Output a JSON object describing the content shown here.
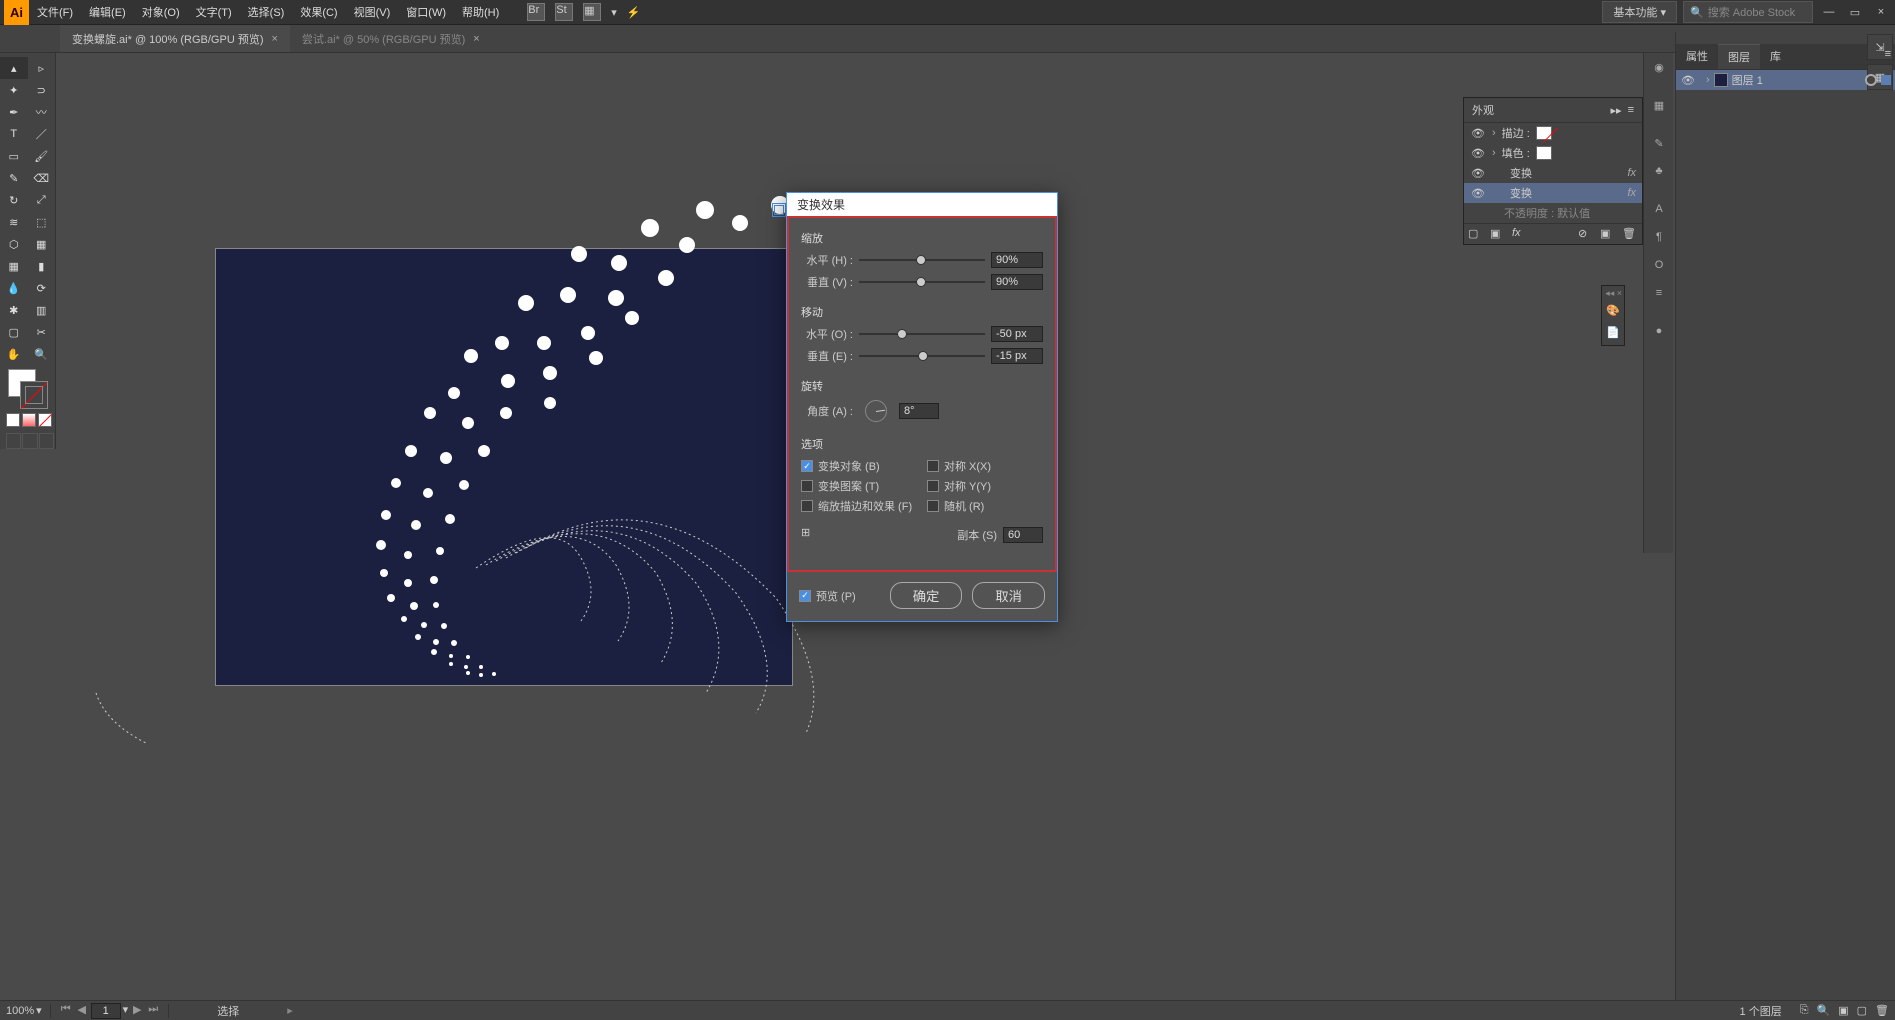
{
  "menu": {
    "items": [
      "文件(F)",
      "编辑(E)",
      "对象(O)",
      "文字(T)",
      "选择(S)",
      "效果(C)",
      "视图(V)",
      "窗口(W)",
      "帮助(H)"
    ],
    "workspace": "基本功能",
    "search_placeholder": "搜索 Adobe Stock"
  },
  "tabs": [
    {
      "label": "变换螺旋.ai* @ 100% (RGB/GPU 预览)",
      "active": true,
      "close": "×"
    },
    {
      "label": "尝试.ai* @ 50% (RGB/GPU 预览)",
      "active": false,
      "close": "×"
    }
  ],
  "dialog": {
    "title": "变换效果",
    "sections": {
      "scale": {
        "title": "缩放",
        "h_label": "水平 (H) :",
        "h_value": "90%",
        "v_label": "垂直 (V) :",
        "v_value": "90%"
      },
      "move": {
        "title": "移动",
        "h_label": "水平 (O) :",
        "h_value": "-50 px",
        "v_label": "垂直 (E) :",
        "v_value": "-15 px"
      },
      "rotate": {
        "title": "旋转",
        "angle_label": "角度 (A) :",
        "angle_value": "8°"
      },
      "options": {
        "title": "选项",
        "transform_obj": "变换对象 (B)",
        "mirror_x": "对称 X(X)",
        "transform_pat": "变换图案 (T)",
        "mirror_y": "对称 Y(Y)",
        "scale_strokes": "缩放描边和效果 (F)",
        "random": "随机 (R)"
      },
      "copies": {
        "label": "副本 (S)",
        "value": "60"
      }
    },
    "preview": "预览 (P)",
    "ok": "确定",
    "cancel": "取消"
  },
  "appearance": {
    "title": "外观",
    "stroke_label": "描边 :",
    "fill_label": "填色 :",
    "transform1": "变换",
    "transform2": "变换",
    "opacity": "不透明度 : 默认值",
    "fx": "fx"
  },
  "layers": {
    "tabs": [
      "属性",
      "图层",
      "库"
    ],
    "layer1": "图层 1",
    "footer": "1 个图层"
  },
  "status": {
    "zoom": "100%",
    "page": "1",
    "mode": "选择"
  }
}
